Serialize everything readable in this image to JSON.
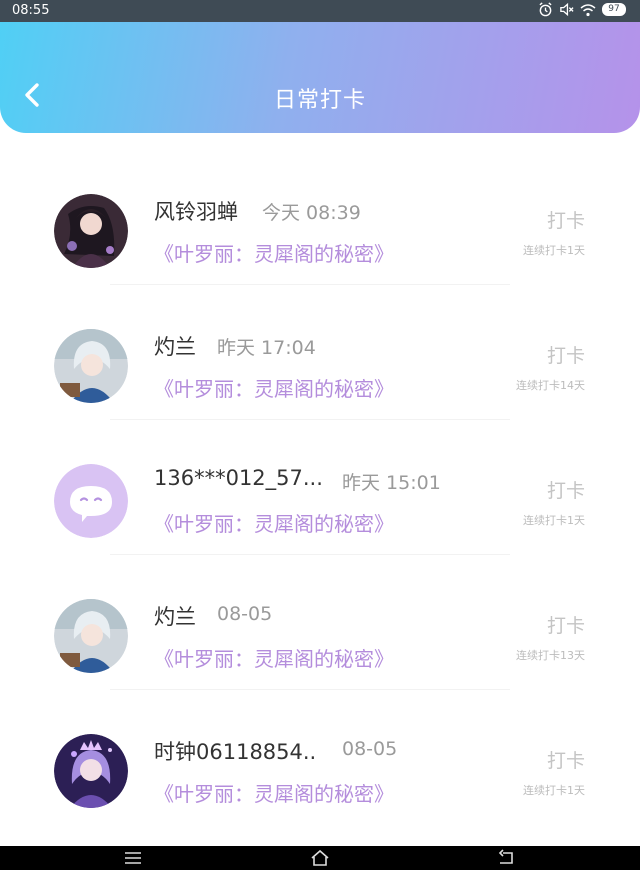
{
  "status_bar": {
    "time": "08:55",
    "battery": "97"
  },
  "header": {
    "title": "日常打卡"
  },
  "items": [
    {
      "name": "风铃羽蝉",
      "time": "今天 08:39",
      "book": "《叶罗丽：灵犀阁的秘密》",
      "action": "打卡",
      "streak": "连续打卡1天",
      "avatar": "anime-girl-dark"
    },
    {
      "name": "灼兰",
      "time": "昨天 17:04",
      "book": "《叶罗丽：灵犀阁的秘密》",
      "action": "打卡",
      "streak": "连续打卡14天",
      "avatar": "anime-girl-blue"
    },
    {
      "name": "136***012_57...",
      "time": "昨天 15:01",
      "book": "《叶罗丽：灵犀阁的秘密》",
      "action": "打卡",
      "streak": "连续打卡1天",
      "avatar": "default-chat-avatar"
    },
    {
      "name": "灼兰",
      "time": "08-05",
      "book": "《叶罗丽：灵犀阁的秘密》",
      "action": "打卡",
      "streak": "连续打卡13天",
      "avatar": "anime-girl-blue"
    },
    {
      "name": "时钟06118854..",
      "time": "08-05",
      "book": "《叶罗丽：灵犀阁的秘密》",
      "action": "打卡",
      "streak": "连续打卡1天",
      "avatar": "anime-girl-purple"
    }
  ],
  "colors": {
    "header_start": "#4fd0f5",
    "header_end": "#b592ea",
    "book_title": "#b48ddc"
  }
}
